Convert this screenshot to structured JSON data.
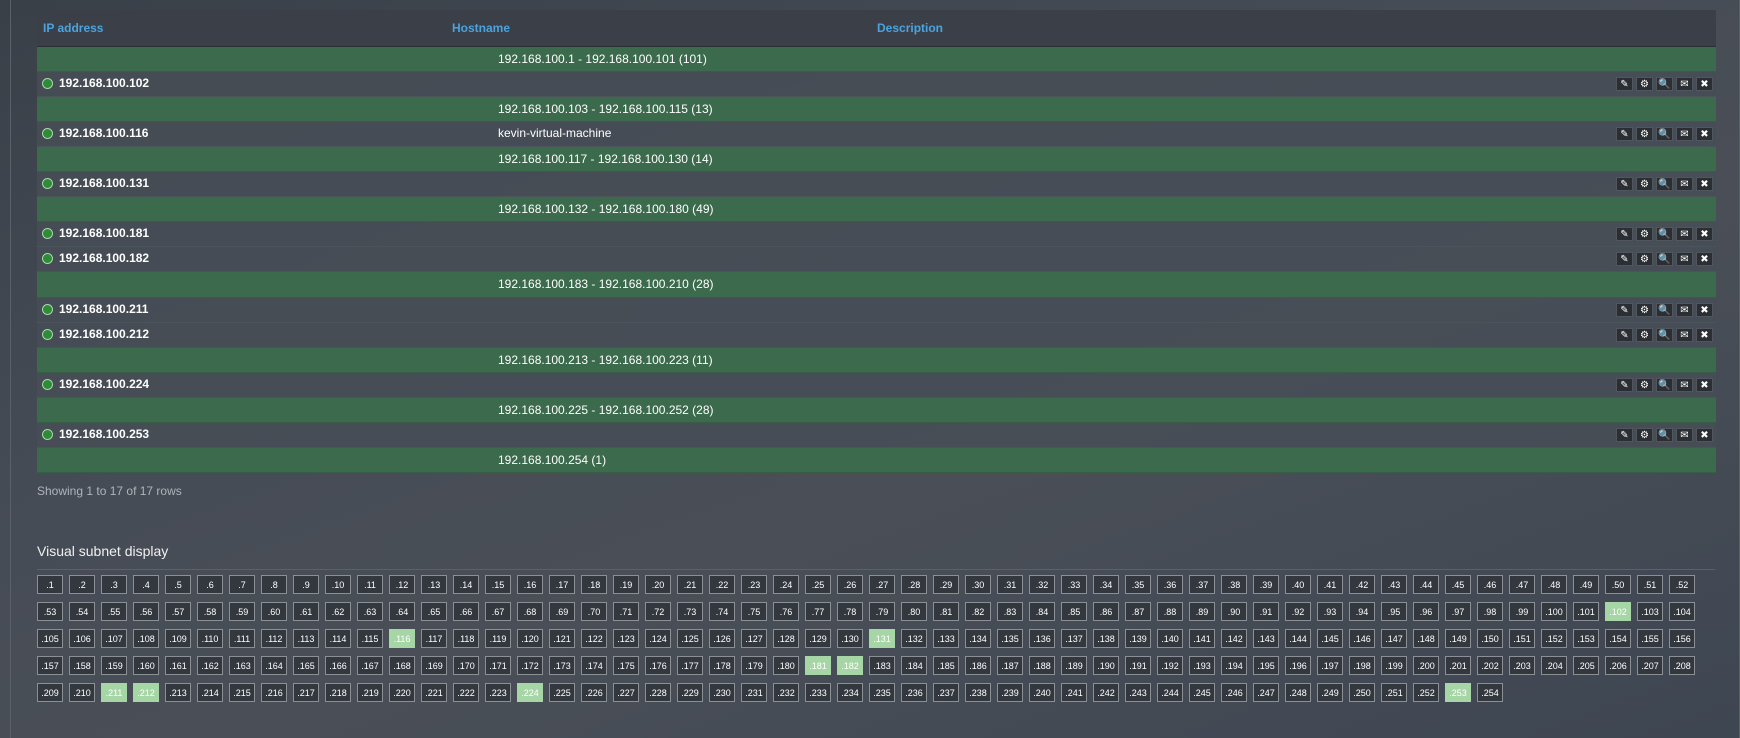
{
  "table": {
    "columns": {
      "ip": "IP address",
      "hostname": "Hostname",
      "description": "Description"
    },
    "rows": [
      {
        "type": "range",
        "text": "192.168.100.1 - 192.168.100.101 (101)"
      },
      {
        "type": "host",
        "ip": "192.168.100.102",
        "hostname": ""
      },
      {
        "type": "range",
        "text": "192.168.100.103 - 192.168.100.115 (13)"
      },
      {
        "type": "host",
        "ip": "192.168.100.116",
        "hostname": "kevin-virtual-machine"
      },
      {
        "type": "range",
        "text": "192.168.100.117 - 192.168.100.130 (14)"
      },
      {
        "type": "host",
        "ip": "192.168.100.131",
        "hostname": ""
      },
      {
        "type": "range",
        "text": "192.168.100.132 - 192.168.100.180 (49)"
      },
      {
        "type": "host",
        "ip": "192.168.100.181",
        "hostname": ""
      },
      {
        "type": "host",
        "ip": "192.168.100.182",
        "hostname": ""
      },
      {
        "type": "range",
        "text": "192.168.100.183 - 192.168.100.210 (28)"
      },
      {
        "type": "host",
        "ip": "192.168.100.211",
        "hostname": ""
      },
      {
        "type": "host",
        "ip": "192.168.100.212",
        "hostname": ""
      },
      {
        "type": "range",
        "text": "192.168.100.213 - 192.168.100.223 (11)"
      },
      {
        "type": "host",
        "ip": "192.168.100.224",
        "hostname": ""
      },
      {
        "type": "range",
        "text": "192.168.100.225 - 192.168.100.252 (28)"
      },
      {
        "type": "host",
        "ip": "192.168.100.253",
        "hostname": ""
      },
      {
        "type": "range",
        "text": "192.168.100.254 (1)"
      }
    ],
    "actions": [
      {
        "name": "edit-icon",
        "glyph": "✎"
      },
      {
        "name": "gears-icon",
        "glyph": "⚙"
      },
      {
        "name": "search-icon",
        "glyph": "🔍"
      },
      {
        "name": "envelope-icon",
        "glyph": "✉"
      },
      {
        "name": "close-icon",
        "glyph": "✖"
      }
    ],
    "footer": "Showing 1 to 17 of 17 rows"
  },
  "subnet": {
    "title": "Visual subnet display",
    "count": 254,
    "used": [
      102,
      116,
      131,
      181,
      182,
      211,
      212,
      224,
      253
    ],
    "colors": {
      "used": "#a6d6a6",
      "free": "#33383e"
    }
  }
}
